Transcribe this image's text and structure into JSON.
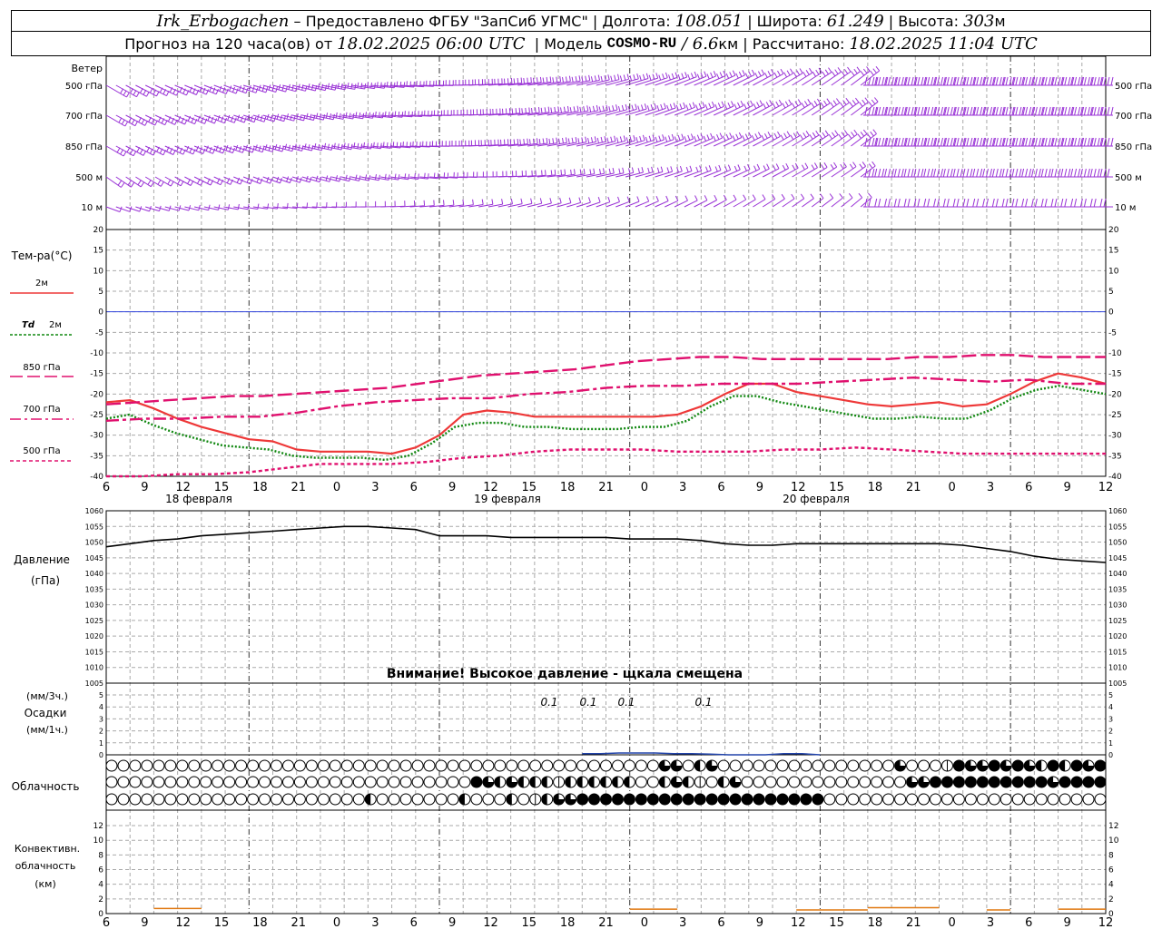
{
  "header": {
    "station": "Irk_Erbogachen",
    "provider": " – Предоставлено ФГБУ \"ЗапСиб УГМС\" | Долгота: ",
    "lon": "108.051",
    "lat_label": " | Широта: ",
    "lat": "61.249",
    "alt_label": " | Высота: ",
    "alt": "303",
    "alt_unit": "м",
    "forecast_prefix": "Прогноз на 120 часа(ов) от ",
    "forecast_start": "18.02.2025 06:00 UTC",
    "model_label": "  | Модель ",
    "model": "COSMO-RU",
    "model_res": " / 6.6",
    "model_res_unit": "км",
    "calc_label": " | Рассчитано: ",
    "calc_time": "18.02.2025 11:04 UTC"
  },
  "time_axis": {
    "hour_labels": [
      "6",
      "9",
      "12",
      "15",
      "18",
      "21",
      "0",
      "3",
      "6",
      "9",
      "12",
      "15",
      "18",
      "21",
      "0",
      "3",
      "6",
      "9",
      "12",
      "15",
      "18",
      "21",
      "0",
      "3",
      "6",
      "9",
      "12"
    ],
    "dates": [
      "18 февраля",
      "19 февраля",
      "20 февраля"
    ]
  },
  "wind_panel": {
    "title": "Ветер",
    "levels": [
      "500 гПа",
      "700 гПа",
      "850 гПа",
      "500 м",
      "10 м"
    ],
    "color": "#9a33d6"
  },
  "colors": {
    "t2m": "#ee3838",
    "td2m": "#118811",
    "t850": "#e0106e",
    "t700": "#e0106e",
    "t500": "#e0106e",
    "pressure": "#000000",
    "precip": "#2244aa",
    "conv": "#e07810",
    "zero_line": "#3344dd"
  },
  "chart_data": [
    {
      "type": "line",
      "title": "Тем-ра(°C)",
      "ylim": [
        -40,
        20
      ],
      "yticks": [
        -40,
        -35,
        -30,
        -25,
        -20,
        -15,
        -10,
        -5,
        0,
        5,
        10,
        15,
        20
      ],
      "x_hours_from_start": [
        0,
        3,
        6,
        9,
        12,
        15,
        18,
        21,
        24,
        27,
        30,
        33,
        36,
        39,
        42,
        45,
        48,
        51,
        54,
        57,
        60,
        63,
        66,
        69,
        72,
        75,
        78,
        81,
        84,
        87,
        90,
        93,
        96,
        99,
        102,
        105,
        108,
        111,
        114,
        117,
        120,
        123,
        126
      ],
      "series": [
        {
          "name": "2м",
          "key": "t2m",
          "style": "solid",
          "values": [
            -22,
            -21.5,
            -23.5,
            -26,
            -28,
            -29.5,
            -31,
            -31.5,
            -33.5,
            -34,
            -34,
            -34,
            -34.5,
            -33,
            -30,
            -25,
            -24,
            -24.5,
            -25.5,
            -25.5,
            -25.5,
            -25.5,
            -25.5,
            -25.5,
            -25,
            -23,
            -20,
            -17.5,
            -17.5,
            -19.5,
            -20.5,
            -21.5,
            -22.5,
            -23,
            -22.5,
            -22,
            -23,
            -22.5,
            -20,
            -17,
            -15,
            -16,
            -17.5
          ]
        },
        {
          "name": "Td 2м",
          "key": "td2m",
          "style": "dotted",
          "values": [
            -26,
            -25,
            -27.5,
            -29.5,
            -31,
            -32.5,
            -33,
            -33.5,
            -35,
            -35.5,
            -35.5,
            -35.5,
            -36,
            -35,
            -32,
            -28,
            -27,
            -27,
            -28,
            -28,
            -28.5,
            -28.5,
            -28.5,
            -28,
            -28,
            -26.5,
            -23,
            -20.5,
            -20.5,
            -22,
            -23,
            -24,
            -25,
            -26,
            -26,
            -25.5,
            -26,
            -26,
            -24,
            -21,
            -19,
            -18,
            -19,
            -20
          ]
        },
        {
          "name": "850 гПа",
          "key": "t850",
          "style": "longdash",
          "values": [
            -22.5,
            -22,
            -21.5,
            -21,
            -20.5,
            -20.5,
            -20,
            -19.5,
            -19,
            -18.5,
            -17.5,
            -16.5,
            -15.5,
            -15,
            -14.5,
            -14,
            -13,
            -12,
            -11.5,
            -11,
            -11,
            -11.5,
            -11.5,
            -11.5,
            -11.5,
            -11.5,
            -11,
            -11,
            -10.5,
            -10.5,
            -11,
            -11,
            -11
          ]
        },
        {
          "name": "700 гПа",
          "key": "t700",
          "style": "dashdot",
          "values": [
            -26.5,
            -26,
            -26,
            -25.5,
            -25.5,
            -24.5,
            -23,
            -22,
            -21.5,
            -21,
            -21,
            -20,
            -19.5,
            -18.5,
            -18,
            -18,
            -17.5,
            -17.5,
            -17.5,
            -17,
            -16.5,
            -16,
            -16.5,
            -17,
            -16.5,
            -17.5,
            -17.5
          ]
        },
        {
          "name": "500 гПа",
          "key": "t500",
          "style": "shortdash",
          "values": [
            -40,
            -40,
            -39.5,
            -39.5,
            -39,
            -38,
            -37,
            -37,
            -37,
            -36.5,
            -35.5,
            -35,
            -34,
            -33.5,
            -33.5,
            -33.5,
            -34,
            -34,
            -34,
            -33.5,
            -33.5,
            -33,
            -33.5,
            -34,
            -34.5,
            -34.5,
            -34.5,
            -34.5,
            -34.5
          ]
        }
      ]
    },
    {
      "type": "line",
      "title": "Давление (гПа)",
      "ylim": [
        1005,
        1060
      ],
      "yticks": [
        1005,
        1010,
        1015,
        1020,
        1025,
        1030,
        1035,
        1040,
        1045,
        1050,
        1055,
        1060
      ],
      "x_hours_from_start": [
        0,
        3,
        6,
        9,
        12,
        15,
        18,
        21,
        24,
        27,
        30,
        33,
        36,
        39,
        42,
        45,
        48,
        51,
        54,
        57,
        60,
        63,
        66,
        69,
        72,
        75,
        78,
        81,
        84,
        87,
        90,
        93,
        96,
        99,
        102,
        105,
        108,
        111,
        114,
        117,
        120,
        123,
        126
      ],
      "series": [
        {
          "name": "Давление",
          "key": "pressure",
          "values": [
            1048.5,
            1049.5,
            1050.5,
            1051,
            1052,
            1052.5,
            1053,
            1053.5,
            1054,
            1054.5,
            1055,
            1055,
            1054.5,
            1054,
            1052,
            1052,
            1052,
            1051.5,
            1051.5,
            1051.5,
            1051.5,
            1051.5,
            1051,
            1051,
            1051,
            1050.5,
            1049.5,
            1049,
            1049,
            1049.5,
            1049.5,
            1049.5,
            1049.5,
            1049.5,
            1049.5,
            1049.5,
            1049,
            1048,
            1047,
            1045.5,
            1044.5,
            1044,
            1043.5
          ]
        }
      ],
      "annotation": "Внимание! Высокое давление - щкала смещена"
    },
    {
      "type": "area",
      "title": "(мм/3ч.) Осадки (мм/1ч.)",
      "ylim": [
        0,
        5
      ],
      "yticks": [
        0,
        1,
        2,
        3,
        4,
        5
      ],
      "x_hours_from_start": [
        60,
        63,
        66,
        69,
        72,
        75,
        78,
        81,
        84,
        87,
        90,
        93,
        96,
        99
      ],
      "series": [
        {
          "name": "Осадки",
          "key": "precip",
          "values": [
            0.1,
            0.1,
            0.15,
            0.15,
            0.15,
            0.1,
            0.1,
            0.05,
            0,
            0,
            0,
            0.1,
            0.1,
            0
          ]
        }
      ],
      "labels": [
        {
          "x_hour": 63,
          "text": "0.1"
        },
        {
          "x_hour": 72,
          "text": "0.1"
        },
        {
          "x_hour": 81,
          "text": "0.1"
        },
        {
          "x_hour": 99,
          "text": "0.1"
        }
      ]
    },
    {
      "type": "table",
      "title": "Облачность",
      "rows": 3,
      "cols": 85,
      "fill_levels": [
        "0000000000000000000000000000000000000000000000000000000000000000000000000000000000000",
        "0000000000000000000000000000000000000000000000000000000000000000000000000000000000000",
        "0000000000000000000000000000000000000000000000000000000000000000000000000000000000000"
      ],
      "legend": "0 = clear, 1 = quarter, 2 = half, 3 = three quarters, 4 = overcast"
    },
    {
      "type": "area",
      "title": "Конвективн. облачность (км)",
      "ylim": [
        0,
        12
      ],
      "yticks": [
        0,
        2,
        4,
        6,
        8,
        10,
        12
      ],
      "x_hours_from_start": [
        0,
        6,
        15,
        18,
        21,
        63,
        69,
        72,
        75,
        174,
        177,
        180,
        183,
        186,
        189,
        192,
        195,
        198,
        201,
        204,
        207,
        210,
        213,
        240,
        243,
        246,
        249,
        252,
        255,
        258,
        261,
        264,
        267,
        270
      ],
      "series": [
        {
          "name": "Конвективн.",
          "key": "conv",
          "segments": [
            {
              "from_hour": 6,
              "to_hour": 12,
              "value": 0.7
            },
            {
              "from_hour": 66,
              "to_hour": 72,
              "value": 0.6
            },
            {
              "from_hour": 87,
              "to_hour": 96,
              "value": 0.5
            },
            {
              "from_hour": 96,
              "to_hour": 105,
              "value": 0.8
            },
            {
              "from_hour": 111,
              "to_hour": 114,
              "value": 0.5
            },
            {
              "from_hour": 120,
              "to_hour": 126,
              "value": 0.6
            }
          ]
        }
      ]
    }
  ],
  "cloud_rows_data": {
    "top": "000000000000000000000000000000000000000000000000000000000033002300000000000000000003002014343434432424434",
    "middle": "0000000000000000000000000000000000000043232222122222222002332102300000000000000000033444444444444342444",
    "bottom": "0000000000000000000000000002000000002000020012333444443444444444444444444400000000000000000000000000000"
  },
  "legend_labels": {
    "temp_title": "Тем-ра(°C)",
    "t2m": "2м",
    "td_sym": "Td",
    "td_h": "2м",
    "t850": "850 гПа",
    "t700": "700 гПа",
    "t500": "500 гПа",
    "press_title": "Давление",
    "press_unit": "(гПа)",
    "precip_u1": "(мм/3ч.)",
    "precip_title": "Осадки",
    "precip_u2": "(мм/1ч.)",
    "cloud_title": "Облачность",
    "conv_1": "Конвективн.",
    "conv_2": "облачность",
    "conv_3": "(км)"
  }
}
